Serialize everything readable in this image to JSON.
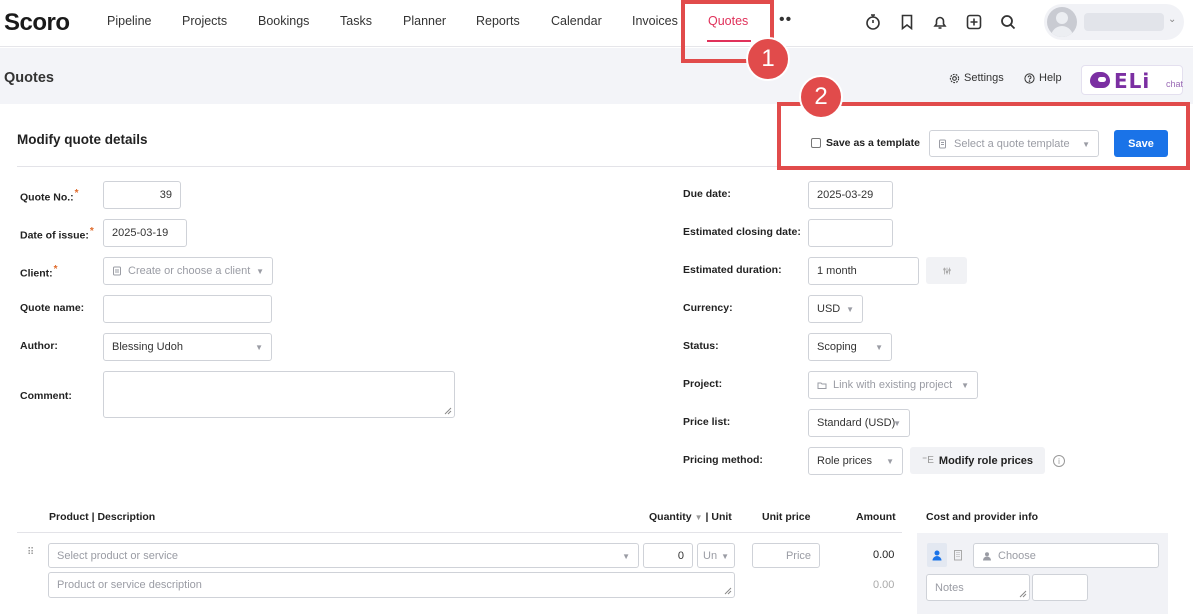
{
  "nav": {
    "logo": "Scoro",
    "items": [
      "Pipeline",
      "Projects",
      "Bookings",
      "Tasks",
      "Planner",
      "Reports",
      "Calendar",
      "Invoices",
      "Quotes"
    ],
    "active": "Quotes",
    "more": "••"
  },
  "header": {
    "title": "Quotes",
    "settings": "Settings",
    "help": "Help",
    "eli_brand": "ELi",
    "eli_chat": "chat"
  },
  "form": {
    "title": "Modify quote details",
    "save_template_label": "Save as a template",
    "template_placeholder": "Select a quote template",
    "save_label": "Save",
    "quote_no_label": "Quote No.:",
    "quote_no_value": "39",
    "date_issue_label": "Date of issue:",
    "date_issue_value": "2025-03-19",
    "client_label": "Client:",
    "client_placeholder": "Create or choose a client",
    "quote_name_label": "Quote name:",
    "author_label": "Author:",
    "author_value": "Blessing Udoh",
    "comment_label": "Comment:",
    "due_date_label": "Due date:",
    "due_date_value": "2025-03-29",
    "closing_label": "Estimated closing date:",
    "duration_label": "Estimated duration:",
    "duration_value": "1 month",
    "currency_label": "Currency:",
    "currency_value": "USD",
    "status_label": "Status:",
    "status_value": "Scoping",
    "project_label": "Project:",
    "project_placeholder": "Link with existing project",
    "price_list_label": "Price list:",
    "price_list_value": "Standard (USD)",
    "pricing_method_label": "Pricing method:",
    "pricing_method_value": "Role prices",
    "modify_role_prices": "Modify role prices",
    "req_mark": "*",
    "info_mark": "i"
  },
  "table": {
    "col_product": "Product | Description",
    "col_quantity": "Quantity",
    "col_unit": "| Unit",
    "col_unit_price": "Unit price",
    "col_amount": "Amount",
    "col_cost": "Cost and provider info",
    "product_placeholder": "Select product or service",
    "qty_value": "0",
    "unit_placeholder": "Un",
    "price_placeholder": "Price",
    "amount_value": "0.00",
    "desc_placeholder": "Product or service description",
    "amount_muted": "0.00",
    "choose_placeholder": "Choose",
    "notes_placeholder": "Notes"
  },
  "annotations": {
    "badge_1": "1",
    "badge_2": "2"
  },
  "colors": {
    "accent": "#e0315a",
    "primary_button": "#1a73e8",
    "annotation": "#e14b4b",
    "eli": "#7b2fa2"
  }
}
